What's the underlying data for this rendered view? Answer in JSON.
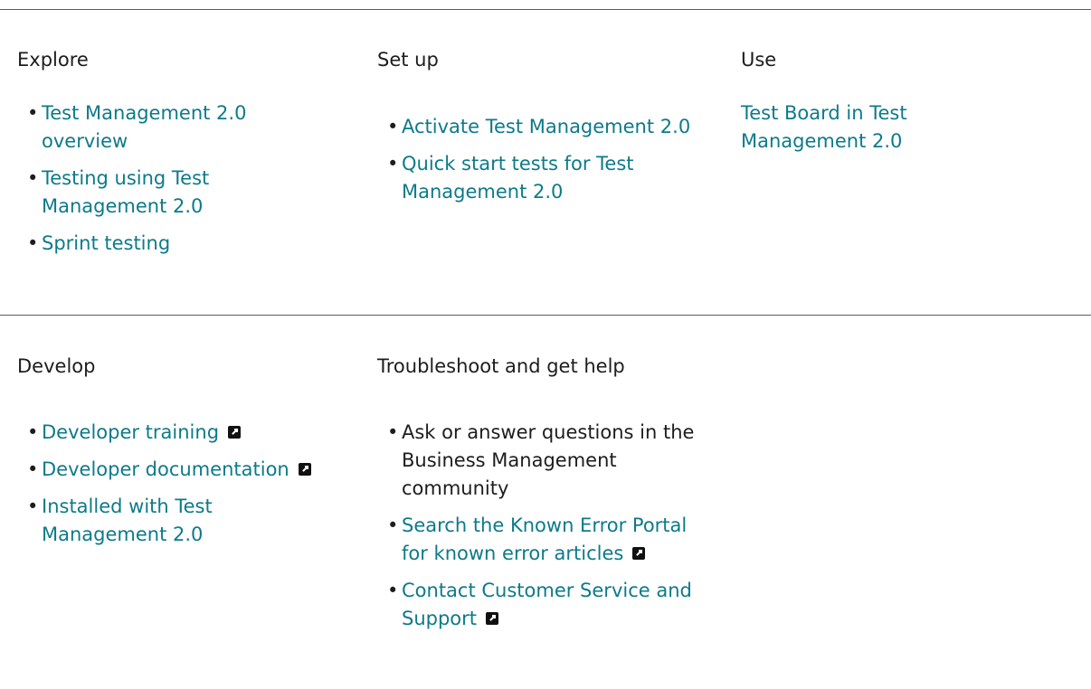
{
  "sections": {
    "explore": {
      "title": "Explore",
      "items": [
        {
          "label": "Test Management 2.0 overview"
        },
        {
          "label": "Testing using Test Management 2.0"
        },
        {
          "label": "Sprint testing"
        }
      ]
    },
    "setup": {
      "title": "Set up",
      "items": [
        {
          "label": "Activate Test Management 2.0"
        },
        {
          "label": "Quick start tests for Test Management 2.0"
        }
      ]
    },
    "use": {
      "title": "Use",
      "link": "Test Board in Test Management 2.0"
    },
    "develop": {
      "title": "Develop",
      "items": [
        {
          "label": "Developer training",
          "external": true
        },
        {
          "label": "Developer documentation",
          "external": true
        },
        {
          "label": "Installed with Test Management 2.0"
        }
      ]
    },
    "troubleshoot": {
      "title": "Troubleshoot and get help",
      "items": [
        {
          "label": "Ask or answer questions in the Business Management community"
        },
        {
          "label": "Search the Known Error Portal for known error articles",
          "external": true
        },
        {
          "label": "Contact Customer Service and Support",
          "external": true
        }
      ]
    }
  },
  "colors": {
    "link": "#0d7a8a",
    "text": "#1d1d1d",
    "rule": "#5c5c5c"
  },
  "icons": {
    "external_link": "external-link-icon",
    "bullet": "bullet-dot"
  }
}
